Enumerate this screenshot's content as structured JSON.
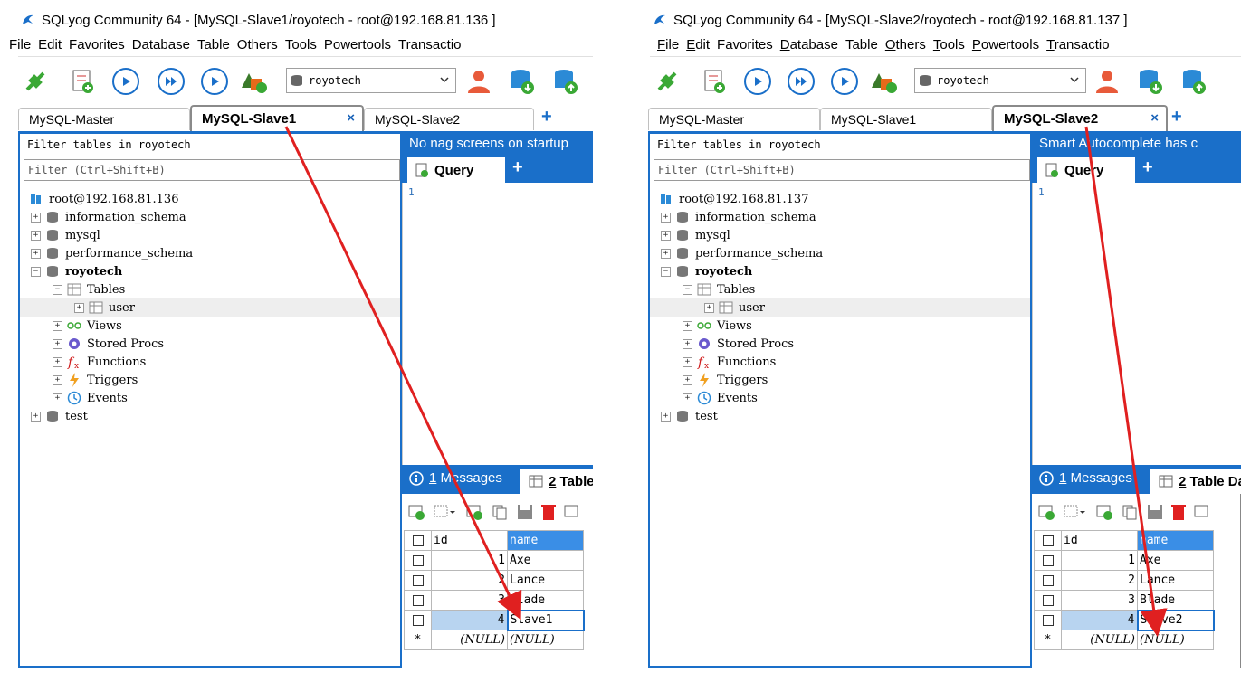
{
  "left": {
    "title": "SQLyog Community 64 - [MySQL-Slave1/royotech - root@192.168.81.136 ]",
    "menu": [
      "File",
      "Edit",
      "Favorites",
      "Database",
      "Table",
      "Others",
      "Tools",
      "Powertools",
      "Transactio"
    ],
    "db_select": "royotech",
    "tabs": [
      "MySQL-Master",
      "MySQL-Slave1",
      "MySQL-Slave2"
    ],
    "active_tab": "MySQL-Slave1",
    "close_glyph": "×",
    "plus_glyph": "+",
    "filter_title": "Filter tables in royotech",
    "filter_placeholder": "Filter (Ctrl+Shift+B)",
    "tree": {
      "root": "root@192.168.81.136",
      "db1": "information_schema",
      "db2": "mysql",
      "db3": "performance_schema",
      "db4": "royotech",
      "tables": "Tables",
      "user": "user",
      "views": "Views",
      "procs": "Stored Procs",
      "functions": "Functions",
      "triggers": "Triggers",
      "events": "Events",
      "db5": "test"
    },
    "banner": "No nag screens on startup",
    "query_tab": "Query",
    "line_no": "1",
    "messages_num": "1",
    "messages_label": "Messages",
    "table_num": "2",
    "table_label": "Table Data",
    "grid": {
      "col_id": "id",
      "col_name": "name",
      "rows": [
        {
          "id": "1",
          "name": "Axe"
        },
        {
          "id": "2",
          "name": "Lance"
        },
        {
          "id": "3",
          "name": "Blade"
        },
        {
          "id": "4",
          "name": "Slave1"
        }
      ],
      "new_marker": "*",
      "null_text": "(NULL)"
    }
  },
  "right": {
    "title": "SQLyog Community 64 - [MySQL-Slave2/royotech - root@192.168.81.137 ]",
    "menu": [
      "File",
      "Edit",
      "Favorites",
      "Database",
      "Table",
      "Others",
      "Tools",
      "Powertools",
      "Transactio"
    ],
    "db_select": "royotech",
    "tabs": [
      "MySQL-Master",
      "MySQL-Slave1",
      "MySQL-Slave2"
    ],
    "active_tab": "MySQL-Slave2",
    "close_glyph": "×",
    "plus_glyph": "+",
    "filter_title": "Filter tables in royotech",
    "filter_placeholder": "Filter (Ctrl+Shift+B)",
    "tree": {
      "root": "root@192.168.81.137",
      "db1": "information_schema",
      "db2": "mysql",
      "db3": "performance_schema",
      "db4": "royotech",
      "tables": "Tables",
      "user": "user",
      "views": "Views",
      "procs": "Stored Procs",
      "functions": "Functions",
      "triggers": "Triggers",
      "events": "Events",
      "db5": "test"
    },
    "banner": "Smart Autocomplete has c",
    "query_tab": "Query",
    "line_no": "1",
    "messages_num": "1",
    "messages_label": "Messages",
    "table_num": "2",
    "table_label": "Table Data",
    "grid": {
      "col_id": "id",
      "col_name": "name",
      "rows": [
        {
          "id": "1",
          "name": "Axe"
        },
        {
          "id": "2",
          "name": "Lance"
        },
        {
          "id": "3",
          "name": "Blade"
        },
        {
          "id": "4",
          "name": "Slave2"
        }
      ],
      "new_marker": "*",
      "null_text": "(NULL)"
    }
  },
  "colors": {
    "accent": "#1a6fc9",
    "arrow": "#e02020",
    "header_sel": "#3a8ee6",
    "row_sel": "#b8d4f0"
  },
  "icons": [
    "sqlyog-dolphin-icon",
    "connect-plug-icon",
    "query-builder-icon",
    "execute-icon",
    "execute-all-icon",
    "execute-edit-icon",
    "schema-designer-icon",
    "database-icon",
    "user-manager-icon",
    "backup-db-icon",
    "restore-db-icon",
    "expand-icon",
    "collapse-icon",
    "table-icon",
    "views-icon",
    "gear-icon",
    "function-icon",
    "trigger-icon",
    "clock-icon",
    "info-icon"
  ]
}
